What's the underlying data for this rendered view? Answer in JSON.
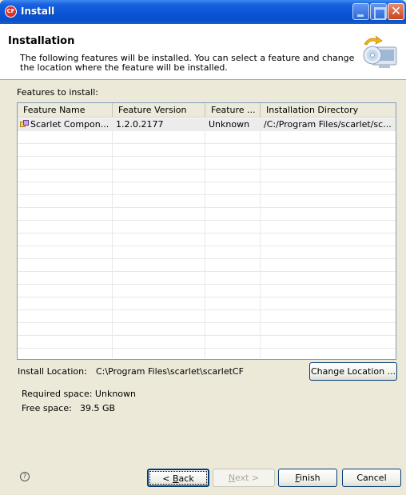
{
  "window": {
    "title": "Install",
    "app_icon_text": "CF"
  },
  "header": {
    "title": "Installation",
    "description": "The following features will be installed. You can select a feature and change the location where the feature will be installed.",
    "icon": "install-cd-icon"
  },
  "features_label": "Features to install:",
  "table": {
    "columns": [
      "Feature Name",
      "Feature Version",
      "Feature ...",
      "Installation Directory"
    ],
    "rows": [
      {
        "name": "Scarlet Compon...",
        "version": "1.2.0.2177",
        "feature": "Unknown",
        "directory": "/C:/Program Files/scarlet/sc..."
      }
    ]
  },
  "install_location": {
    "label": "Install Location:",
    "value": "C:\\Program Files\\scarlet\\scarletCF",
    "change_button": "Change Location ..."
  },
  "space": {
    "required": "Required space: Unknown",
    "free_label": "Free space:",
    "free_value": "39.5 GB"
  },
  "footer": {
    "help_icon": "help-icon",
    "back_label_pre": "< ",
    "back_label_key": "B",
    "back_label_post": "ack",
    "next_label_key": "N",
    "next_label_post": "ext >",
    "finish_label_key": "F",
    "finish_label_post": "inish",
    "cancel_label": "Cancel"
  },
  "colors": {
    "titlebar": "#0a55d6",
    "dialog_bg": "#ece9d8",
    "row_selected": "#ececec"
  }
}
